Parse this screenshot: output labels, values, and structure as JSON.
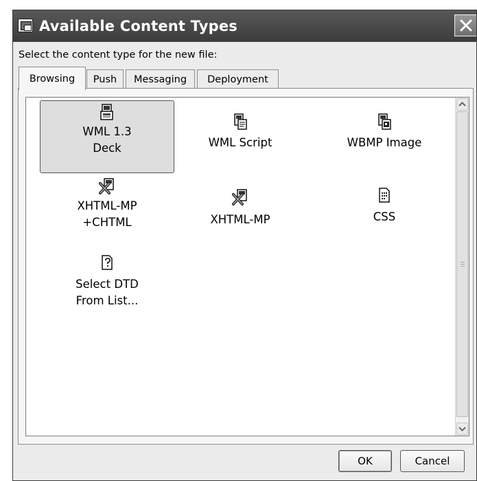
{
  "window": {
    "title": "Available Content Types",
    "close_label": "close"
  },
  "prompt": "Select the content type for the new file:",
  "tabs": [
    {
      "label": "Browsing",
      "active": true
    },
    {
      "label": "Push",
      "active": false
    },
    {
      "label": "Messaging",
      "active": false
    },
    {
      "label": "Deployment",
      "active": false
    }
  ],
  "items": [
    {
      "label": "WML 1.3\nDeck",
      "icon": "wml-deck-icon",
      "selected": true
    },
    {
      "label": "WML Script",
      "icon": "wml-script-icon",
      "selected": false
    },
    {
      "label": "WBMP Image",
      "icon": "wbmp-image-icon",
      "selected": false
    },
    {
      "label": "XHTML-MP\n+CHTML",
      "icon": "xhtml-mp-chtml-icon",
      "selected": false
    },
    {
      "label": "XHTML-MP",
      "icon": "xhtml-mp-icon",
      "selected": false
    },
    {
      "label": "CSS",
      "icon": "css-icon",
      "selected": false
    },
    {
      "label": "Select DTD\nFrom List...",
      "icon": "select-dtd-icon",
      "selected": false
    }
  ],
  "buttons": {
    "ok": "OK",
    "cancel": "Cancel"
  },
  "colors": {
    "title_bar": "#4a4a4a",
    "dialog_bg": "#ececec",
    "list_bg": "#ffffff",
    "selection": "#dedede"
  }
}
